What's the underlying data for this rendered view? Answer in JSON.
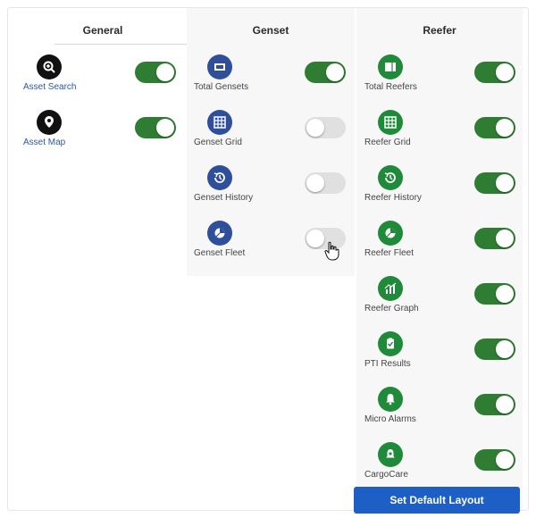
{
  "colors": {
    "toggle_on": "#2e7d32",
    "toggle_off": "#e0e0e0",
    "general_icon": "#111111",
    "genset_icon": "#2f4f9a",
    "reefer_icon": "#1f8a3a",
    "genset_label": "#444444",
    "general_label": "#2a58a8",
    "button_bg": "#1e5fc6"
  },
  "columns": {
    "general": {
      "title": "General",
      "items": [
        {
          "label": "Asset Search",
          "icon": "search-map-icon",
          "enabled": true
        },
        {
          "label": "Asset Map",
          "icon": "map-pin-icon",
          "enabled": true
        }
      ]
    },
    "genset": {
      "title": "Genset",
      "items": [
        {
          "label": "Total Gensets",
          "icon": "genset-box-icon",
          "enabled": true
        },
        {
          "label": "Genset Grid",
          "icon": "grid-icon",
          "enabled": false
        },
        {
          "label": "Genset History",
          "icon": "history-icon",
          "enabled": false
        },
        {
          "label": "Genset Fleet",
          "icon": "pie-chart-icon",
          "enabled": false
        }
      ]
    },
    "reefer": {
      "title": "Reefer",
      "items": [
        {
          "label": "Total Reefers",
          "icon": "reefer-box-icon",
          "enabled": true
        },
        {
          "label": "Reefer Grid",
          "icon": "grid-icon",
          "enabled": true
        },
        {
          "label": "Reefer History",
          "icon": "history-icon",
          "enabled": true
        },
        {
          "label": "Reefer Fleet",
          "icon": "pie-chart-icon",
          "enabled": true
        },
        {
          "label": "Reefer Graph",
          "icon": "bar-graph-icon",
          "enabled": true
        },
        {
          "label": "PTI Results",
          "icon": "clipboard-check-icon",
          "enabled": true
        },
        {
          "label": "Micro Alarms",
          "icon": "bell-icon",
          "enabled": true
        },
        {
          "label": "CargoCare",
          "icon": "cargo-care-icon",
          "enabled": true
        }
      ]
    }
  },
  "footer": {
    "set_default_label": "Set Default Layout"
  }
}
